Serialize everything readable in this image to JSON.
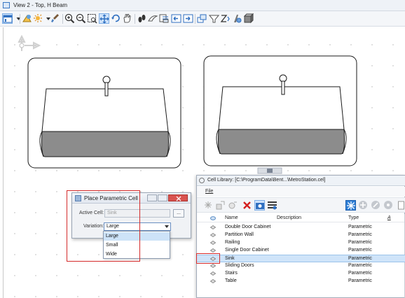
{
  "window": {
    "title": "View 2 - Top, H Beam"
  },
  "toolbar": {
    "icons": [
      "view-attributes-icon",
      "dropdown-arrow-icon",
      "display-style-icon",
      "lighting-icon",
      "brush-icon",
      "zoom-in-icon",
      "zoom-out-icon",
      "window-area-icon",
      "fit-view-icon",
      "rotate-view-icon",
      "pan-view-icon",
      "walk-icon",
      "fly-icon",
      "view-previous-icon",
      "view-next-icon",
      "view-copy-icon",
      "clip-volume-icon",
      "clip-mask-icon",
      "standard-view-icon",
      "camera-icon",
      "render-icon"
    ]
  },
  "dialog": {
    "title": "Place Parametric Cell",
    "active_cell_label": "Active Cell:",
    "active_cell_value": "Sink",
    "browse_label": "...",
    "variation_label": "Variation:",
    "variation_value": "Large",
    "options": [
      "Large",
      "Small",
      "Wide"
    ],
    "highlighted_option": "Large"
  },
  "cell_library": {
    "title": "Cell Library: [C:\\ProgramData\\Bent...\\MetroStation.cel]",
    "menu": [
      "File"
    ],
    "columns": {
      "name": "Name",
      "description": "Description",
      "type": "Type"
    },
    "rows": [
      {
        "name": "Double Door Cabinet",
        "type": "Parametric"
      },
      {
        "name": "Partition Wall",
        "type": "Parametric"
      },
      {
        "name": "Railing",
        "type": "Parametric"
      },
      {
        "name": "Single Door Cabinet",
        "type": "Parametric"
      },
      {
        "name": "Sink",
        "type": "Parametric"
      },
      {
        "name": "Sliding Doors",
        "type": "Parametric"
      },
      {
        "name": "Stairs",
        "type": "Parametric"
      },
      {
        "name": "Table",
        "type": "Parametric"
      }
    ],
    "selected_row": "Sink"
  },
  "colors": {
    "highlight_box": "#d42a2a",
    "selection": "#cfe4f9",
    "sink_shadow": "#8c8c8c"
  }
}
